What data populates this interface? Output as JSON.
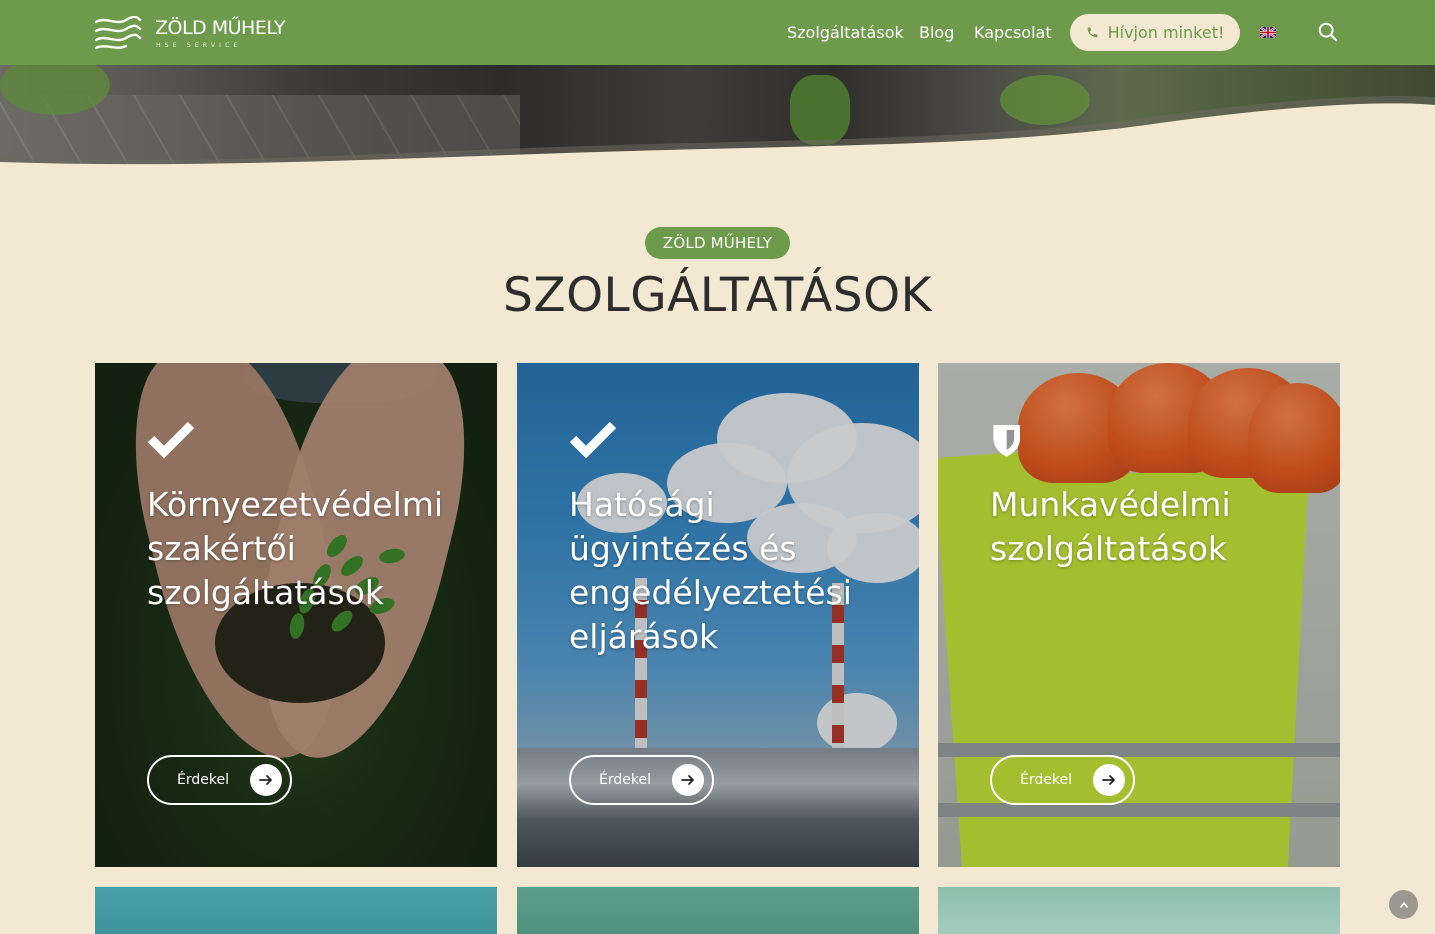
{
  "header": {
    "logo": {
      "name": "ZÖLD MŰHELY",
      "sub": "HSE SERVICE"
    },
    "nav": [
      {
        "label": "Szolgáltatások"
      },
      {
        "label": "Blog"
      },
      {
        "label": "Kapcsolat"
      }
    ],
    "call_button": "Hívjon minket!",
    "language_icon": "uk-flag-icon",
    "search_icon": "search-icon"
  },
  "section": {
    "badge": "ZÖLD MŰHELY",
    "title": "SZOLGÁLTATÁSOK"
  },
  "cards": [
    {
      "icon": "check-icon",
      "title": "Környezetvédelmi szakértői szolgáltatások",
      "button": "Érdekel"
    },
    {
      "icon": "check-icon",
      "title": "Hatósági ügyintézés és engedélyeztetési eljárások",
      "button": "Érdekel"
    },
    {
      "icon": "shield-icon",
      "title": "Munkavédelmi szolgáltatások",
      "button": "Érdekel"
    }
  ],
  "colors": {
    "brand_green": "#6d9b4b",
    "cream": "#f3e8d1",
    "title_dark": "#2d2d2d"
  }
}
